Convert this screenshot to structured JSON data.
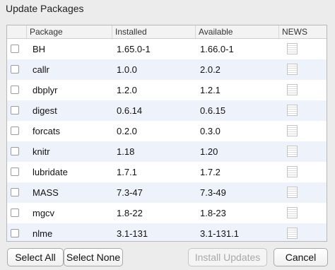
{
  "window": {
    "title": "Update Packages"
  },
  "table": {
    "columns": [
      "",
      "Package",
      "Installed",
      "Available",
      "NEWS"
    ],
    "rows": [
      {
        "package": "BH",
        "installed": "1.65.0-1",
        "available": "1.66.0-1"
      },
      {
        "package": "callr",
        "installed": "1.0.0",
        "available": "2.0.2"
      },
      {
        "package": "dbplyr",
        "installed": "1.2.0",
        "available": "1.2.1"
      },
      {
        "package": "digest",
        "installed": "0.6.14",
        "available": "0.6.15"
      },
      {
        "package": "forcats",
        "installed": "0.2.0",
        "available": "0.3.0"
      },
      {
        "package": "knitr",
        "installed": "1.18",
        "available": "1.20"
      },
      {
        "package": "lubridate",
        "installed": "1.7.1",
        "available": "1.7.2"
      },
      {
        "package": "MASS",
        "installed": "7.3-47",
        "available": "7.3-49"
      },
      {
        "package": "mgcv",
        "installed": "1.8-22",
        "available": "1.8-23"
      },
      {
        "package": "nlme",
        "installed": "3.1-131",
        "available": "3.1-131.1"
      }
    ]
  },
  "buttons": {
    "select_all": "Select All",
    "select_none": "Select None",
    "install_updates": "Install Updates",
    "cancel": "Cancel"
  },
  "icons": {
    "news": "news-document-icon",
    "checkbox": "checkbox-unchecked"
  },
  "colors": {
    "alt_row": "#eef3fb",
    "window_bg": "#ececec"
  }
}
